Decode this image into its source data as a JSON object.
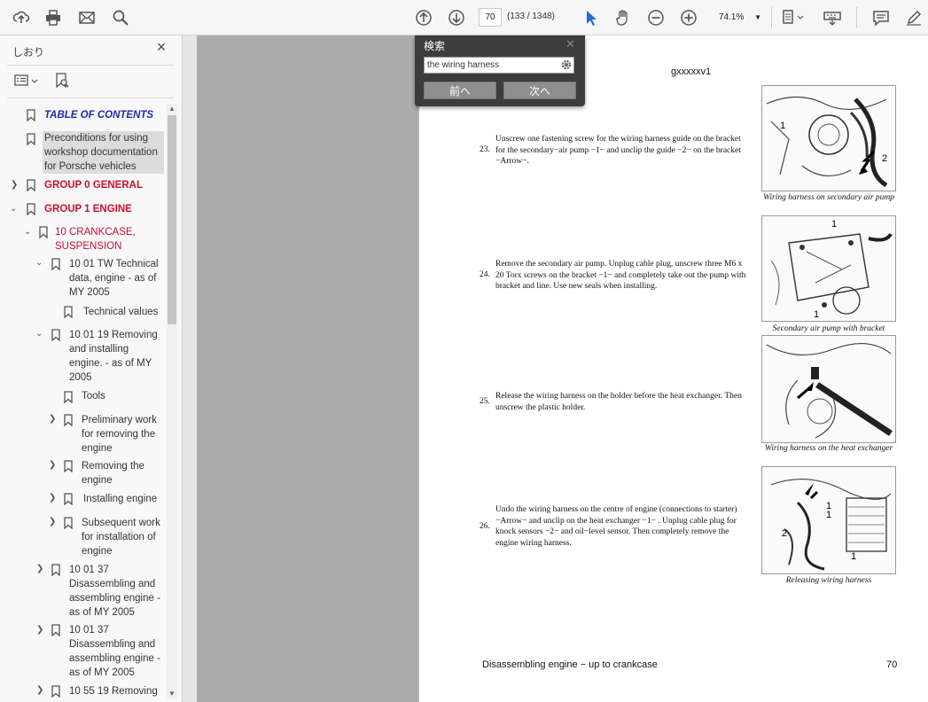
{
  "toolbar": {
    "page_number": "70",
    "page_count": "(133 / 1348)",
    "zoom": "74.1%"
  },
  "sidebar": {
    "title": "しおり",
    "items": [
      {
        "label": "TABLE OF CONTENTS",
        "style": "blue"
      },
      {
        "label": "Preconditions for using workshop documentation for Porsche vehicles",
        "style": "normal"
      },
      {
        "label": "GROUP 0 GENERAL",
        "style": "red"
      },
      {
        "label": "GROUP 1 ENGINE",
        "style": "red"
      },
      {
        "label": "10 CRANKCASE, SUSPENSION",
        "style": "red2"
      },
      {
        "label": "10 01 TW Technical data, engine - as of MY 2005",
        "style": "normal"
      },
      {
        "label": "Technical values",
        "style": "normal"
      },
      {
        "label": "10 01 19 Removing and installing engine. - as of MY 2005",
        "style": "normal"
      },
      {
        "label": "Tools",
        "style": "normal"
      },
      {
        "label": "Preliminary work for removing the engine",
        "style": "normal"
      },
      {
        "label": "Removing the engine",
        "style": "normal"
      },
      {
        "label": "Installing engine",
        "style": "normal"
      },
      {
        "label": "Subsequent work for installation of engine",
        "style": "normal"
      },
      {
        "label": "10 01 37 Disassembling and assembling engine - as of MY 2005",
        "style": "normal"
      },
      {
        "label": "10 01 37 Disassembling and assembling engine - as of MY 2005",
        "style": "normal"
      },
      {
        "label": "10 55 19 Removing",
        "style": "normal"
      }
    ]
  },
  "search": {
    "title": "検索",
    "query": "the wiring harness",
    "prev_label": "前へ",
    "next_label": "次へ"
  },
  "page": {
    "header": "gxxxxxv1",
    "steps": [
      {
        "num": "23.",
        "text": "Unscrew one fastening screw for the wiring harness guide on the bracket for the secondary−air pump −1− and unclip the guide −2− on the bracket −Arrow−."
      },
      {
        "num": "24.",
        "text": "Remove the secondary air pump. Unplug cable plug, unscrew three M6 x 20 Torx screws on the bracket −1− and completely take out the pump with bracket and line. Use new seals when installing."
      },
      {
        "num": "25.",
        "text": "Release the wiring harness on the holder before the heat exchanger. Then unscrew the plastic holder."
      },
      {
        "num": "26.",
        "text": "Undo the wiring harness on the centre of engine (connections to starter) −Arrow− and unclip on the heat exchanger −1− . Unplug cable plug for knock sensors −2− and oil−level sensor. Then completely remove the engine wiring harness."
      }
    ],
    "captions": [
      "Wiring harness on secondary air pump",
      "Secondary air pump with bracket",
      "Wiring harness on the heat exchanger",
      "Releasing wiring harness"
    ],
    "fig_labels": [
      "1",
      "2",
      "1",
      "1",
      "1",
      "2",
      "1",
      "1"
    ],
    "footer": "Disassembling engine − up to crankcase",
    "page_num": "70"
  }
}
